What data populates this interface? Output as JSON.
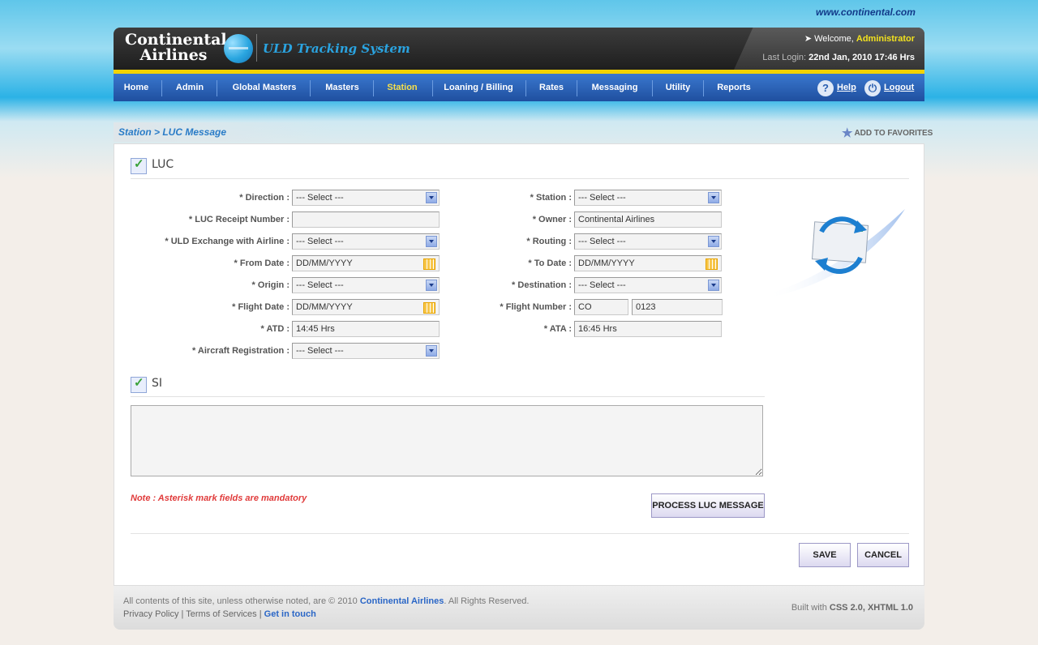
{
  "site_url": "www.continental.com",
  "header": {
    "logo_line1": "Continental",
    "logo_line2": "Airlines",
    "app_title": "ULD Tracking System",
    "welcome_prefix": "Welcome, ",
    "username": "Administrator",
    "last_login_label": "Last Login: ",
    "last_login_value": "22nd Jan, 2010 17:46 Hrs"
  },
  "nav": {
    "items": [
      "Home",
      "Admin",
      "Global Masters",
      "Masters",
      "Station",
      "Loaning / Billing",
      "Rates",
      "Messaging",
      "Utility",
      "Reports"
    ],
    "active": "Station",
    "help": "Help",
    "logout": "Logout"
  },
  "breadcrumb": "Station > LUC Message",
  "add_to_favorites": "ADD TO FAVORITES",
  "luc": {
    "title": "LUC",
    "direction": {
      "label": "* Direction :",
      "value": "--- Select ---"
    },
    "receipt_number": {
      "label": "* LUC Receipt Number :",
      "value": ""
    },
    "exchange_airline": {
      "label": "* ULD Exchange with Airline :",
      "value": "--- Select ---"
    },
    "from_date": {
      "label": "* From Date :",
      "value": "DD/MM/YYYY"
    },
    "origin": {
      "label": "* Origin :",
      "value": "--- Select ---"
    },
    "flight_date": {
      "label": "* Flight Date :",
      "value": "DD/MM/YYYY"
    },
    "atd": {
      "label": "* ATD :",
      "value": "14:45 Hrs"
    },
    "aircraft_registration": {
      "label": "* Aircraft Registration :",
      "value": "--- Select ---"
    },
    "station": {
      "label": "* Station :",
      "value": "--- Select ---"
    },
    "owner": {
      "label": "* Owner :",
      "value": "Continental Airlines"
    },
    "routing": {
      "label": "* Routing :",
      "value": "--- Select ---"
    },
    "to_date": {
      "label": "* To Date :",
      "value": "DD/MM/YYYY"
    },
    "destination": {
      "label": "* Destination :",
      "value": "--- Select ---"
    },
    "flight_number": {
      "label": "* Flight Number :",
      "carrier": "CO",
      "number": "0123"
    },
    "ata": {
      "label": "* ATA :",
      "value": "16:45 Hrs"
    }
  },
  "si": {
    "title": "SI",
    "value": ""
  },
  "note": "Note : Asterisk mark fields are mandatory",
  "buttons": {
    "process": "PROCESS LUC MESSAGE",
    "save": "SAVE",
    "cancel": "CANCEL"
  },
  "footer": {
    "copyright_prefix": "All contents of this site, unless otherwise noted, are © 2010 ",
    "copyright_brand": "Continental Airlines",
    "copyright_suffix": ". All Rights Reserved.",
    "privacy": "Privacy Policy",
    "terms": "Terms of Services",
    "contact": "Get in touch",
    "built_with_prefix": "Built with ",
    "built_with_tech": "CSS 2.0, XHTML 1.0"
  },
  "colors": {
    "nav_active": "#f6e04b",
    "accent_yellow": "#f3d300",
    "link_blue": "#2a66c6",
    "note_red": "#e03a3a"
  }
}
